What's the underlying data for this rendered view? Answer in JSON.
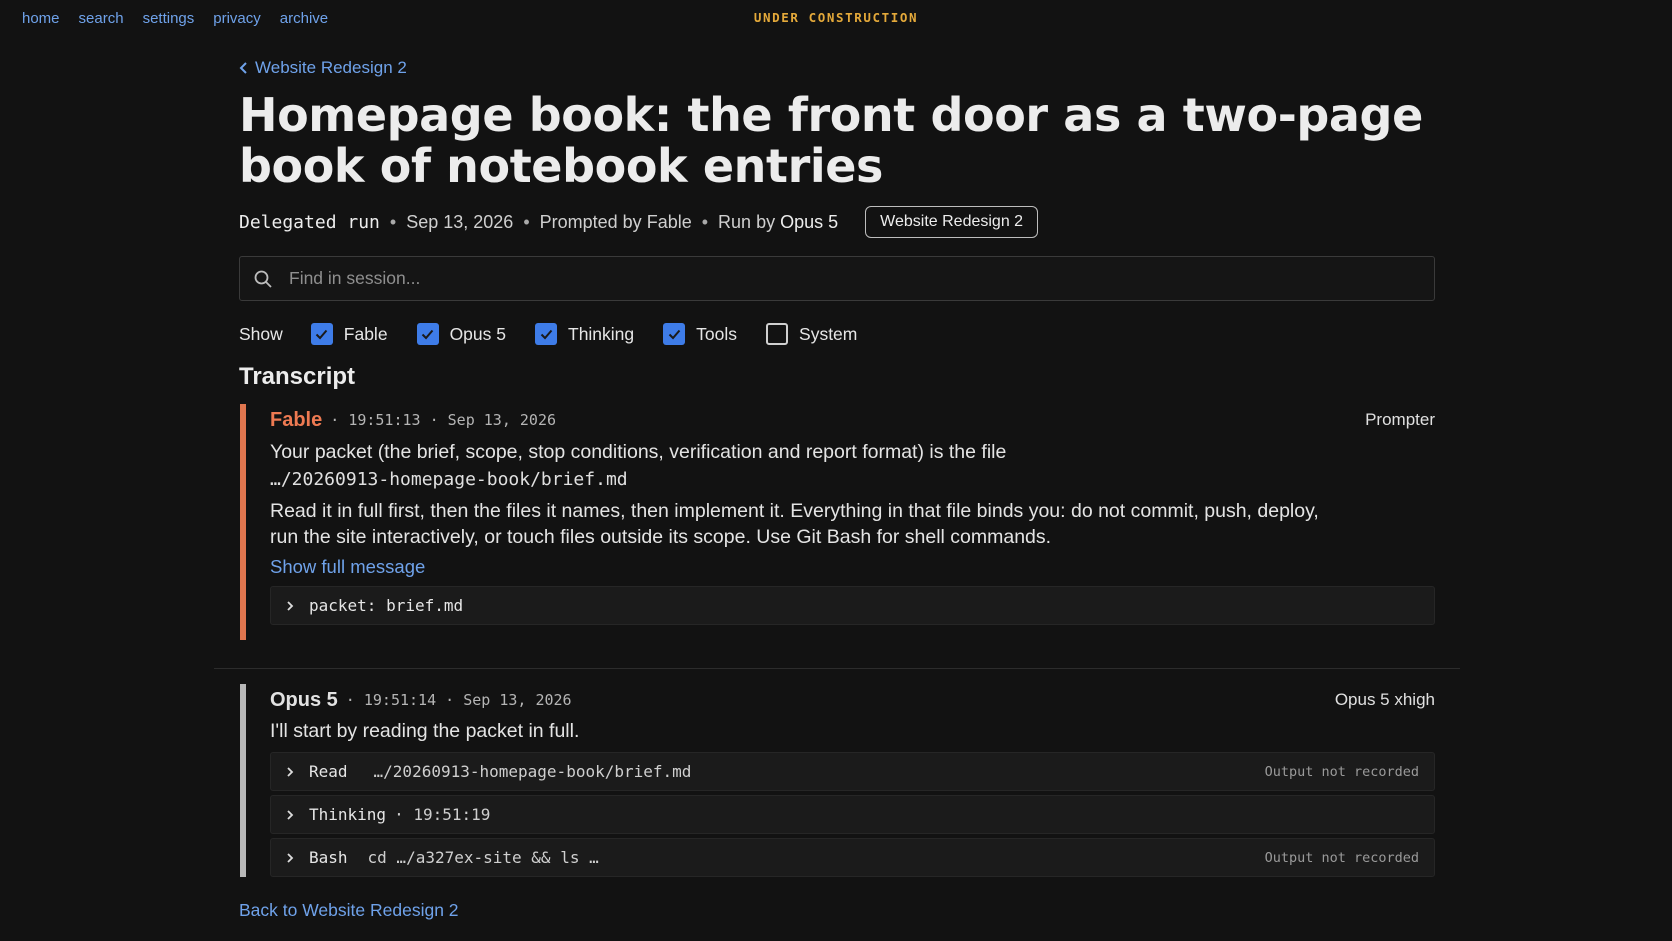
{
  "nav": [
    "home",
    "search",
    "settings",
    "privacy",
    "archive"
  ],
  "banner": "UNDER CONSTRUCTION",
  "breadcrumb": "Website Redesign 2",
  "title": "Homepage book: the front door as a two-page book of notebook entries",
  "meta": {
    "type": "Delegated run",
    "date": "Sep 13, 2026",
    "prompted_prefix": "Prompted by",
    "prompted_by": "Fable",
    "run_prefix": "Run by",
    "run_by": "Opus 5",
    "project_pill": "Website Redesign 2"
  },
  "search": {
    "placeholder": "Find in session..."
  },
  "filters": {
    "label": "Show",
    "options": [
      {
        "label": "Fable",
        "checked": true
      },
      {
        "label": "Opus 5",
        "checked": true
      },
      {
        "label": "Thinking",
        "checked": true
      },
      {
        "label": "Tools",
        "checked": true
      },
      {
        "label": "System",
        "checked": false
      }
    ]
  },
  "transcript_heading": "Transcript",
  "messages": [
    {
      "author": "Fable",
      "time": "19:51:13",
      "date": "Sep 13, 2026",
      "role": "Prompter",
      "text1": "Your packet (the brief, scope, stop conditions, verification and report format) is the file",
      "path": "…/20260913-homepage-book/brief.md",
      "text2": "Read it in full first, then the files it names, then implement it. Everything in that file binds you: do not commit, push, deploy, run the site interactively, or touch files outside its scope. Use Git Bash for shell commands.",
      "show_full": "Show full message",
      "attachment_label": "packet:",
      "attachment_file": "brief.md"
    },
    {
      "author": "Opus 5",
      "time": "19:51:14",
      "date": "Sep 13, 2026",
      "role": "Opus 5 xhigh",
      "text": "I'll start by reading the packet in full.",
      "tools": [
        {
          "name": "Read",
          "arg": "…/20260913-homepage-book/brief.md",
          "status": "Output not recorded"
        },
        {
          "name": "Thinking",
          "arg": "· 19:51:19",
          "status": ""
        },
        {
          "name": "Bash",
          "arg": "cd …/a327ex-site && ls …",
          "status": "Output not recorded"
        }
      ]
    }
  ],
  "back_link": "Back to Website Redesign 2",
  "colors": {
    "accent_link": "#6fa2ea",
    "fable": "#ee7a52",
    "banner": "#e4a93a",
    "checkbox": "#3e7ce8"
  },
  "icons": [
    "search-icon",
    "check-icon",
    "chevron-left-icon",
    "chevron-right-icon"
  ]
}
